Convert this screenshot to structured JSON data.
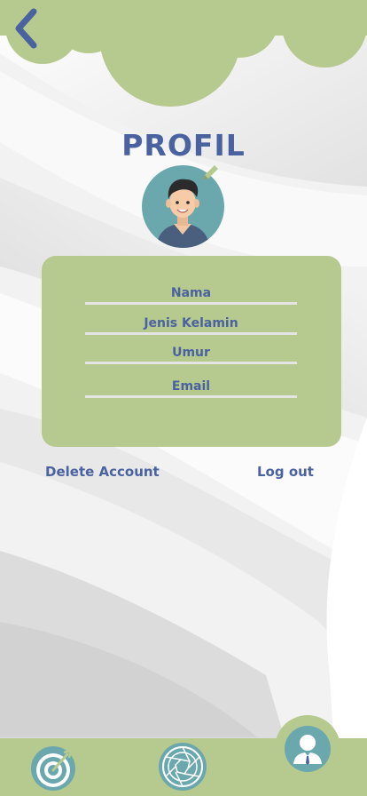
{
  "page": {
    "title": "PROFIL"
  },
  "header": {
    "back_icon": "chevron-left-icon"
  },
  "profile": {
    "avatar_icon": "user-avatar-illustration",
    "edit_icon": "pencil-icon",
    "fields": [
      {
        "label": "Nama",
        "value": ""
      },
      {
        "label": "Jenis Kelamin",
        "value": ""
      },
      {
        "label": "Umur",
        "value": ""
      },
      {
        "label": "Email",
        "value": ""
      }
    ]
  },
  "actions": {
    "delete_label": "Delete Account",
    "logout_label": "Log out"
  },
  "nav": {
    "items": [
      {
        "icon": "target-icon",
        "active": false
      },
      {
        "icon": "camera-aperture-icon",
        "active": false
      },
      {
        "icon": "profile-icon",
        "active": true
      }
    ]
  },
  "colors": {
    "accent": "#4a62a0",
    "green": "#b6c98e",
    "teal": "#6ba8ae",
    "line": "#e4e4e4"
  }
}
